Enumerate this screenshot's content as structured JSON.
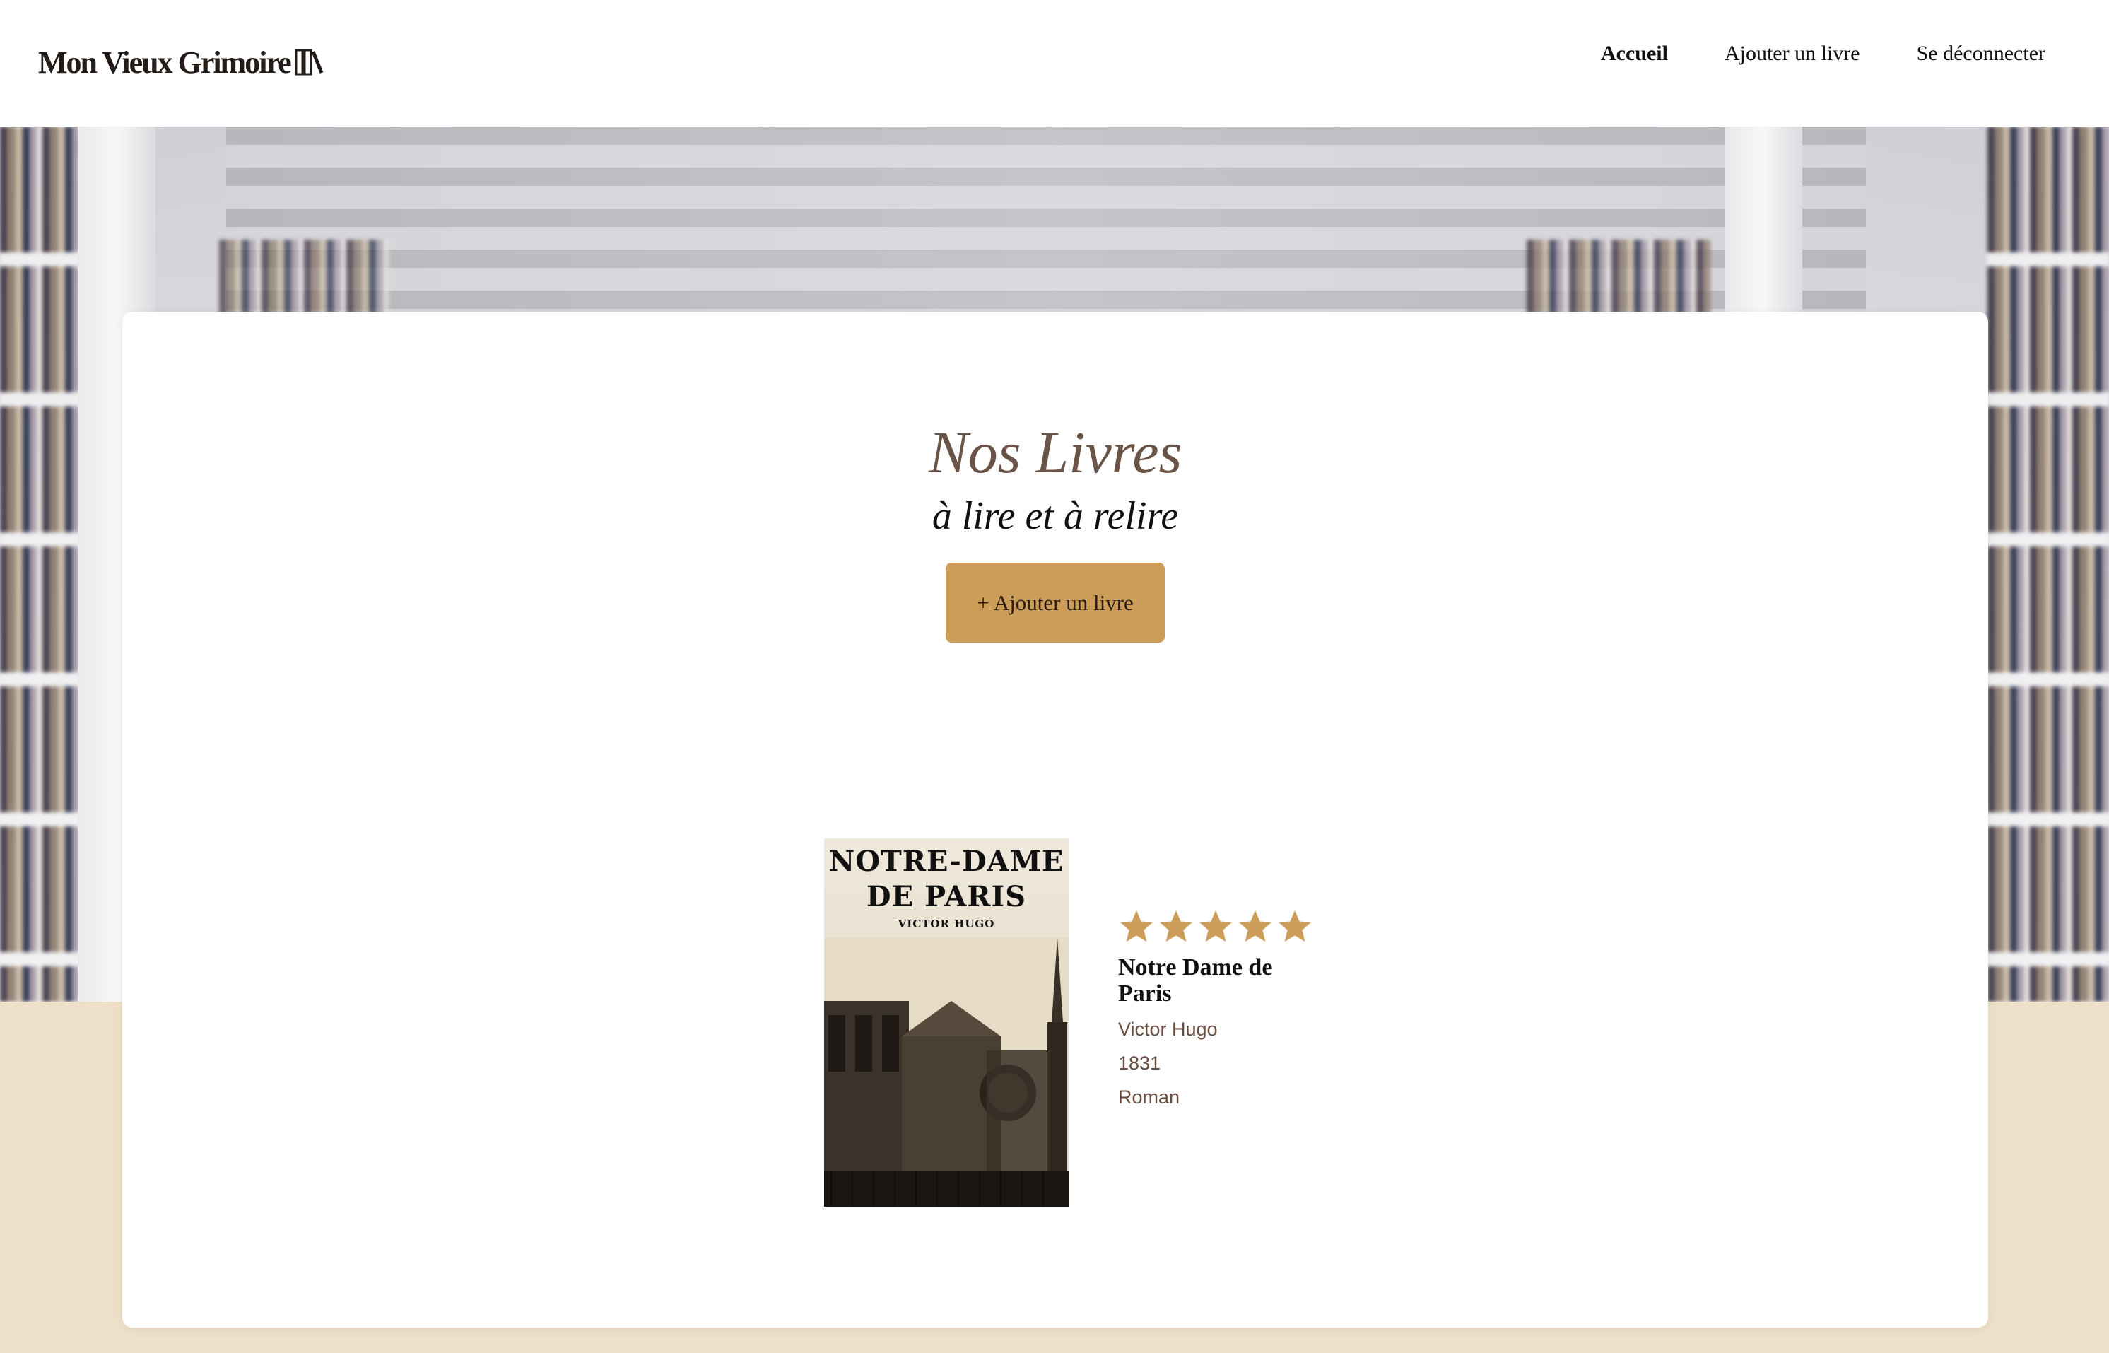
{
  "header": {
    "logo_text": "Mon Vieux Grimoire",
    "nav": [
      "Accueil",
      "Ajouter un livre",
      "Se déconnecter"
    ],
    "active_nav": "Accueil"
  },
  "main": {
    "title": "Nos Livres",
    "subtitle": "à lire et à relire",
    "add_button": "+ Ajouter un livre"
  },
  "books": [
    {
      "cover_title_line1": "NOTRE-DAME",
      "cover_title_line2": "DE PARIS",
      "cover_author": "VICTOR HUGO",
      "title": "Notre Dame de Paris",
      "author": "Victor Hugo",
      "year": "1831",
      "genre": "Roman",
      "rating": 5,
      "rating_max": 5
    }
  ],
  "colors": {
    "accent": "#cc9d58",
    "title_brown": "#6a5347",
    "meta_brown": "#6b4d40",
    "page_beige": "#efe1c9"
  }
}
